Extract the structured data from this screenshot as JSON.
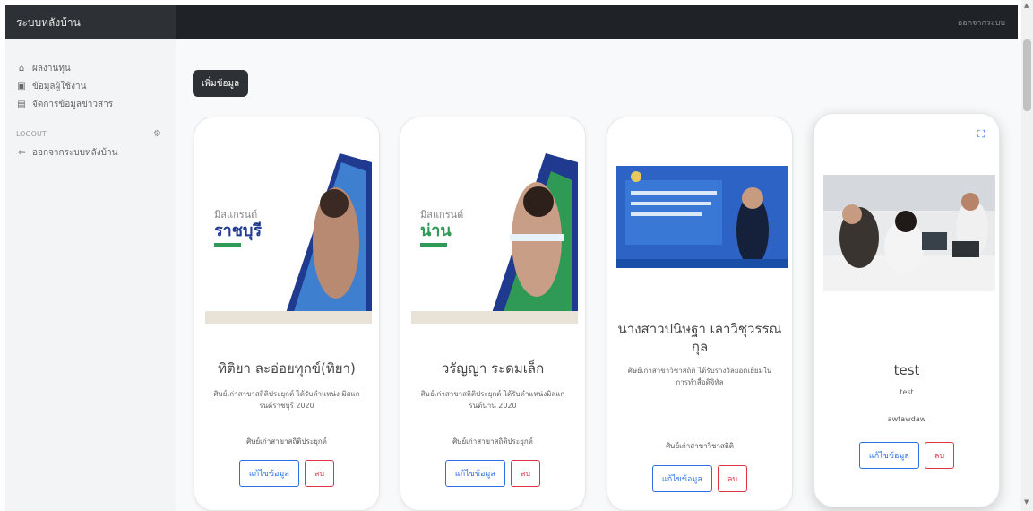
{
  "header": {
    "brand": "ระบบหลังบ้าน",
    "user_menu": "ออกจากระบบ"
  },
  "sidebar": {
    "items": [
      {
        "label": "ผลงานทุน",
        "icon": "home-icon"
      },
      {
        "label": "ข้อมูลผู้ใช้งาน",
        "icon": "user-card-icon"
      },
      {
        "label": "จัดการข้อมูลข่าวสาร",
        "icon": "news-icon"
      }
    ],
    "section_label": "LOGOUT",
    "logout_label": "ออกจากระบบหลังบ้าน"
  },
  "main": {
    "add_button": "เพิ่มข้อมูล",
    "cards": [
      {
        "title": "ทิติยา ละอ่อยทุกข์(ทิยา)",
        "description": "ศิษย์เก่าสาขาสถิติประยุกต์ ได้รับตำแหน่ง มิสแกรนด์ราชบุรี 2020",
        "category": "ศิษย์เก่าสาขาสถิติประยุกต์",
        "edit_label": "แก้ไขข้อมูล",
        "delete_label": "ลบ",
        "poster_title": "มิสแกรนด์",
        "poster_province": "ราชบุรี"
      },
      {
        "title": "วรัญญา ระดมเล็ก",
        "description": "ศิษย์เก่าสาขาสถิติประยุกต์ ได้รับตำแหน่งมิสแกรนด์น่าน 2020",
        "category": "ศิษย์เก่าสาขาสถิติประยุกต์",
        "edit_label": "แก้ไขข้อมูล",
        "delete_label": "ลบ",
        "poster_title": "มิสแกรนด์",
        "poster_province": "น่าน"
      },
      {
        "title": "นางสาวปนิษฐา เลาวิชุวรรณกุล",
        "description": "ศิษย์เก่าสาขาวิชาสถิติ ได้รับรางวัลยอดเยี่ยมในการทำสื่อดิจิทัล",
        "category": "ศิษย์เก่าสาขาวิชาสถิติ",
        "edit_label": "แก้ไขข้อมูล",
        "delete_label": "ลบ"
      },
      {
        "title": "test",
        "description": "test",
        "category": "awtawdaw",
        "edit_label": "แก้ไขข้อมูล",
        "delete_label": "ลบ"
      }
    ]
  }
}
